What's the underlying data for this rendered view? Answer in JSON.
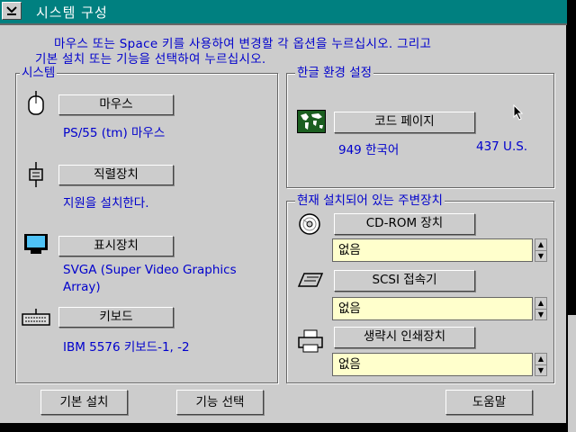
{
  "title": "시스템 구성",
  "instructions": {
    "line1": "마우스 또는 Space 키를 사용하여 변경할 각 옵션을 누르십시오. 그리고",
    "line2": "기본 설치 또는 기능을 선택하여 누르십시오."
  },
  "system": {
    "label": "시스템",
    "mouse": {
      "button": "마우스",
      "value": "PS/55 (tm) 마우스",
      "icon": "mouse-icon"
    },
    "serial": {
      "button": "직렬장치",
      "value": "지원을 설치한다.",
      "icon": "serial-port-icon"
    },
    "display": {
      "button": "표시장치",
      "value_line1": "SVGA (Super Video Graphics",
      "value_line2": "Array)",
      "icon": "monitor-icon"
    },
    "keyboard": {
      "button": "키보드",
      "value": "IBM 5576 키보드-1, -2",
      "icon": "keyboard-icon"
    }
  },
  "hangul": {
    "label": "한글 환경 설정",
    "codepage_button": "코드 페이지",
    "codepage_value": "949 한국어",
    "codepage_alt": "437 U.S.",
    "icon": "world-map-icon"
  },
  "peripherals": {
    "label": "현재 설치되어 있는 주변장치",
    "cdrom": {
      "button": "CD-ROM 장치",
      "value": "없음",
      "icon": "cd-icon"
    },
    "scsi": {
      "button": "SCSI 접속기",
      "value": "없음",
      "icon": "scsi-icon"
    },
    "printer": {
      "button": "생략시 인쇄장치",
      "value": "없음",
      "icon": "printer-icon"
    }
  },
  "footer": {
    "default_install": "기본 설치",
    "select_features": "기능 선택",
    "help": "도움말"
  },
  "colors": {
    "titlebar": "#008080",
    "text_accent": "#0000cc",
    "field_bg": "#ffffcc",
    "window_bg": "#cccccc"
  }
}
